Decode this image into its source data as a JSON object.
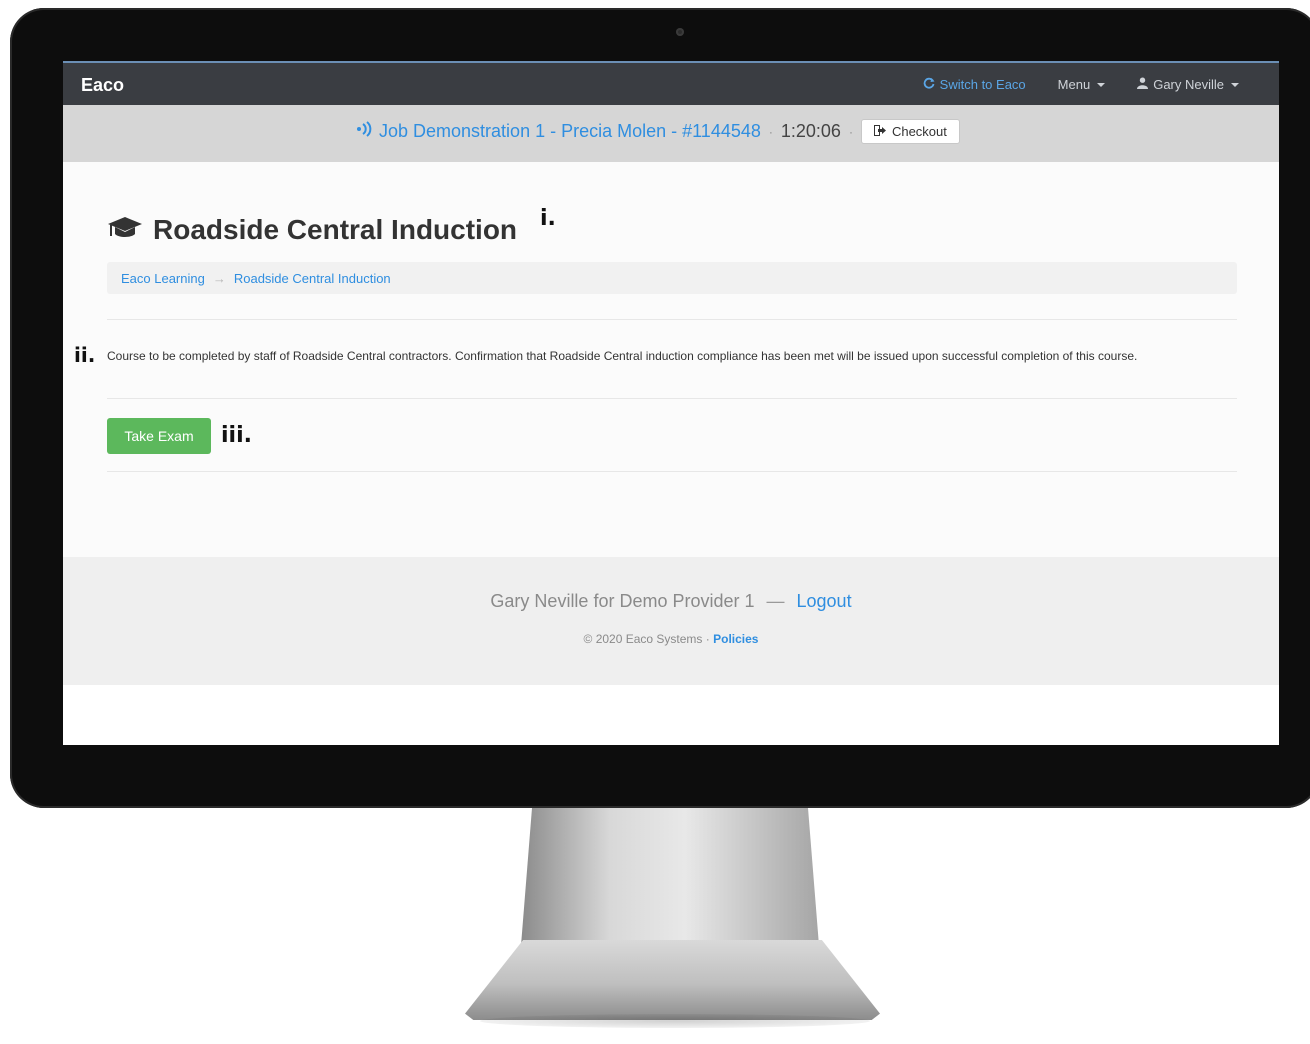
{
  "navbar": {
    "brand": "Eaco",
    "switch_label": "Switch to Eaco",
    "menu_label": "Menu",
    "user_label": "Gary Neville"
  },
  "jobbar": {
    "job_label": "Job Demonstration 1 - Precia Molen - #1144548",
    "separator": "·",
    "timer": "1:20:06",
    "checkout_label": "Checkout"
  },
  "page": {
    "title": "Roadside Central Induction",
    "breadcrumb": [
      {
        "label": "Eaco Learning"
      },
      {
        "label": "Roadside Central Induction"
      }
    ],
    "breadcrumb_sep": "→",
    "description": "Course to be completed by staff of Roadside Central contractors. Confirmation that Roadside Central induction compliance has been met will be issued upon successful completion of this course.",
    "take_exam_label": "Take Exam"
  },
  "footer": {
    "user_text": "Gary Neville for Demo Provider 1",
    "dash": "—",
    "logout_label": "Logout",
    "copyright": "© 2020 Eaco Systems ·",
    "policies_label": "Policies"
  },
  "markers": {
    "one": "i.",
    "two": "ii.",
    "three": "iii."
  },
  "colors": {
    "navbar_bg": "#3a3d42",
    "link_blue": "#2f8ee0",
    "button_green": "#5cb85c"
  },
  "icons": {
    "switch": "refresh-icon",
    "user": "user-icon",
    "job": "broadcast-icon",
    "checkout": "sign-out-icon",
    "title": "graduation-cap-icon"
  }
}
